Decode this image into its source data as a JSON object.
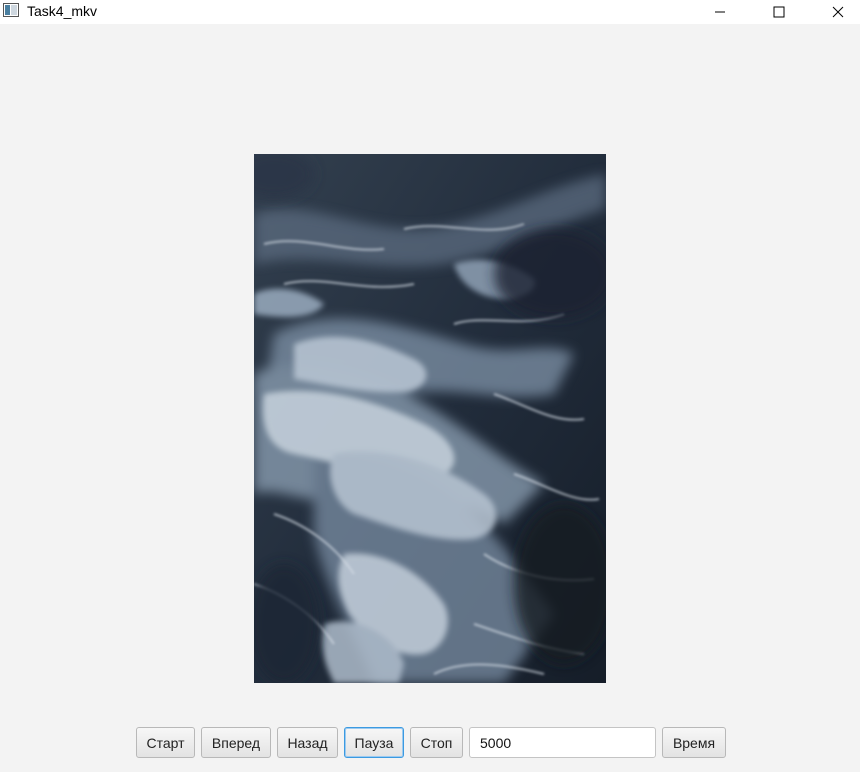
{
  "window": {
    "title": "Task4_mkv",
    "controls": {
      "minimize": "minimize-icon",
      "maximize": "maximize-icon",
      "close": "close-icon"
    }
  },
  "viewer": {
    "image_subject": "ocean-waves-foam-photo"
  },
  "toolbar": {
    "start_label": "Старт",
    "forward_label": "Вперед",
    "back_label": "Назад",
    "pause_label": "Пауза",
    "stop_label": "Стоп",
    "delay_value": "5000",
    "time_label": "Время"
  },
  "colors": {
    "background": "#f3f3f3",
    "focus_accent": "#3b9ae1",
    "water_dark": "#1b2433",
    "foam": "#c9d3de"
  }
}
